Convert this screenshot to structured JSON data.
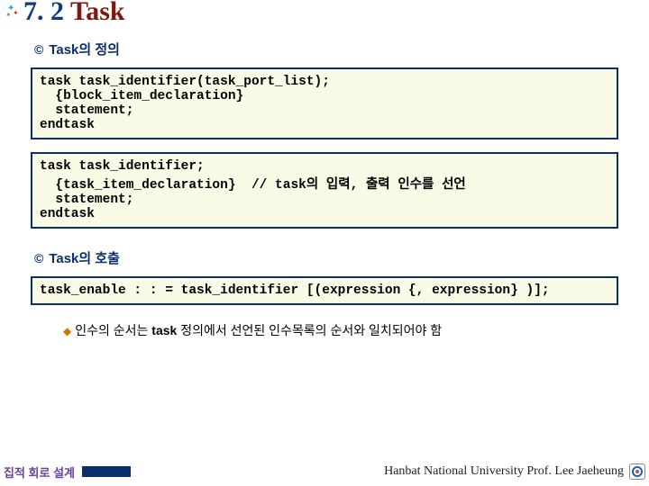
{
  "title": {
    "number": "7. 2",
    "word": " Task"
  },
  "sections": {
    "definition": {
      "heading": "Task의 정의"
    },
    "call": {
      "heading": "Task의 호출"
    }
  },
  "codeboxes": {
    "box1": "task task_identifier(task_port_list);\n  {block_item_declaration}\n  statement;\nendtask",
    "box2": "task task_identifier;\n  {task_item_declaration}  // task의 입력, 출력 인수를 선언\n  statement;\nendtask",
    "box3": "task_enable : : = task_identifier [(expression {, expression} )];"
  },
  "bullet": {
    "prefix": "인수의 순서는 ",
    "bold": "task",
    "suffix": " 정의에서 선언된 인수목록의 순서와 일치되어야 함"
  },
  "footer": {
    "left": "집적 회로 설계",
    "right": "Hanbat National University Prof. Lee Jaeheung"
  }
}
